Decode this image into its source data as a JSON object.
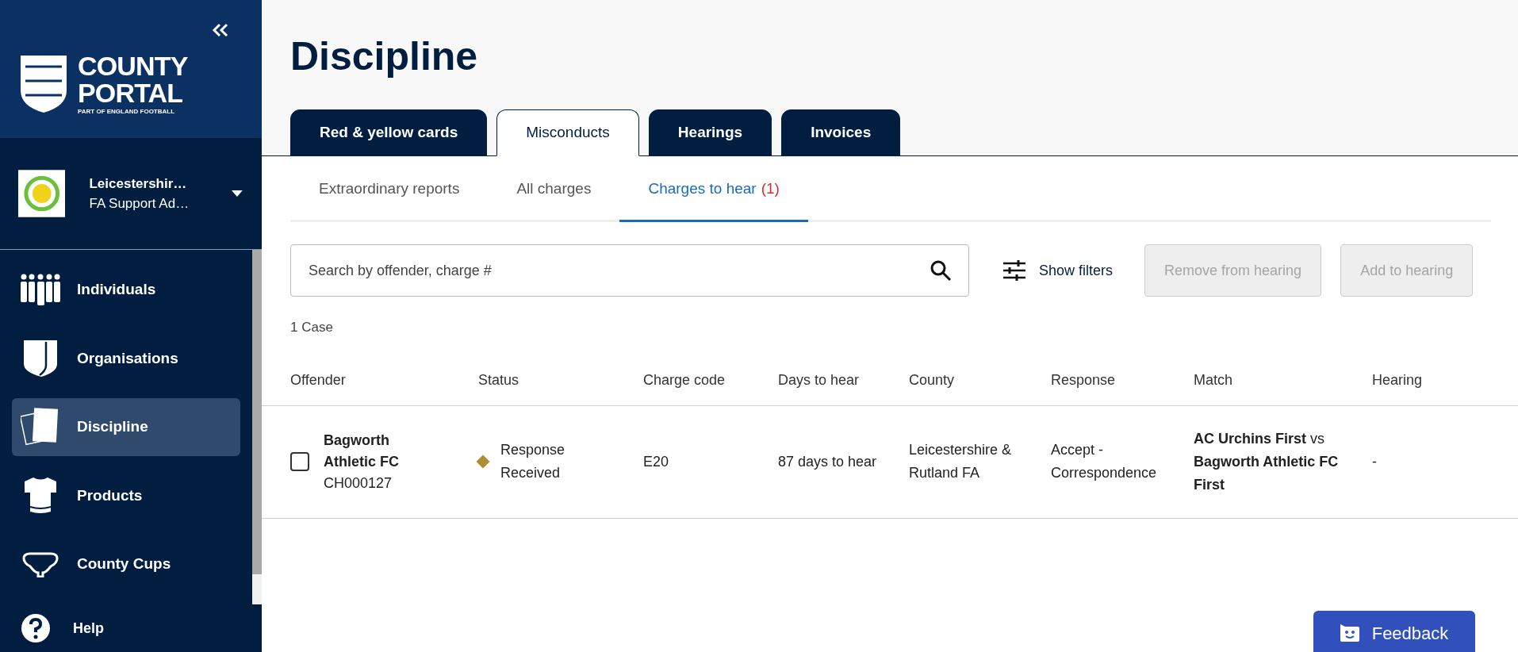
{
  "sidebar": {
    "logo": {
      "line1": "COUNTY",
      "line2": "PORTAL",
      "tagline": "PART OF ENGLAND FOOTBALL"
    },
    "account": {
      "name": "Leicestershir…",
      "role": "FA Support Ad…"
    },
    "nav": [
      {
        "kind": "people",
        "label": "Individuals",
        "selected": false
      },
      {
        "kind": "shield",
        "label": "Organisations",
        "selected": false
      },
      {
        "kind": "cards",
        "label": "Discipline",
        "selected": true
      },
      {
        "kind": "shirt",
        "label": "Products",
        "selected": false
      },
      {
        "kind": "trophy",
        "label": "County Cups",
        "selected": false
      }
    ],
    "help": {
      "label": "Help"
    }
  },
  "main": {
    "title": "Discipline",
    "tabs": [
      {
        "label": "Red & yellow cards",
        "selected": false
      },
      {
        "label": "Misconducts",
        "selected": true
      },
      {
        "label": "Hearings",
        "selected": false
      },
      {
        "label": "Invoices",
        "selected": false
      }
    ],
    "subtabs": [
      {
        "label": "Extraordinary reports",
        "selected": false
      },
      {
        "label": "All charges",
        "selected": false
      },
      {
        "label": "Charges to hear",
        "count": "(1)",
        "selected": true
      }
    ],
    "search": {
      "placeholder": "Search by offender, charge #"
    },
    "filters": {
      "label": "Show filters"
    },
    "actions": [
      {
        "label": "Remove from hearing",
        "disabled": true
      },
      {
        "label": "Add to hearing",
        "disabled": true
      }
    ],
    "case_count": "1 Case",
    "table": {
      "columns": [
        "Offender",
        "Status",
        "Charge code",
        "Days to hear",
        "County",
        "Response",
        "Match",
        "Hearing"
      ],
      "rows": [
        {
          "checked": false,
          "offender": "Bagworth Athletic FC",
          "charge_id": "CH000127",
          "status": "Response Received",
          "color": "#b08d2e",
          "charge_code": "E20",
          "days": "87 days to hear",
          "county": "Leicestershire & Rutland FA",
          "response": "Accept - Correspondence",
          "match": "**AC Urchins First** vs **Bagworth Athletic FC First**",
          "hearing": "-"
        }
      ]
    },
    "feedback": {
      "label": "Feedback"
    }
  }
}
